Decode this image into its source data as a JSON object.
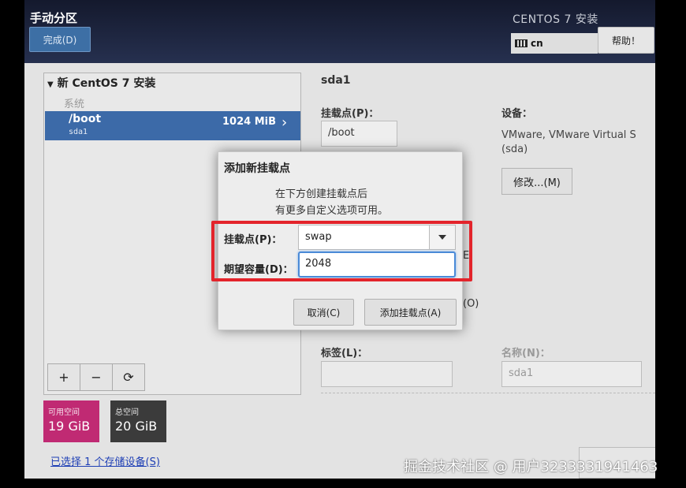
{
  "header": {
    "page_title": "手动分区",
    "done_label": "完成(D)",
    "install_title": "CENTOS 7 安装",
    "keyboard_layout": "cn",
    "help_label": "帮助！"
  },
  "tree": {
    "root_label": "新 CentOS 7 安装",
    "group_label": "系统",
    "partition": {
      "mount": "/boot",
      "device": "sda1",
      "size": "1024 MiB"
    },
    "buttons": {
      "add": "+",
      "remove": "−",
      "refresh": "⟳"
    }
  },
  "space": {
    "available_label": "可用空间",
    "available_value": "19 GiB",
    "total_label": "总空间",
    "total_value": "20 GiB"
  },
  "storage_link": "已选择 1 个存储设备(S)",
  "detail": {
    "title": "sda1",
    "mount_label": "挂载点(P)：",
    "mount_value": "/boot",
    "device_label": "设备：",
    "device_value": "VMware, VMware Virtual S (sda)",
    "modify_label": "修改...(M)",
    "frag_e": "E",
    "frag_o": "(O)",
    "tag_label": "标签(L)：",
    "tag_value": "",
    "name_label": "名称(N)：",
    "name_value": "sda1"
  },
  "dialog": {
    "title": "添加新挂载点",
    "desc_line1": "在下方创建挂载点后",
    "desc_line2": "有更多自定义选项可用。",
    "mount_label": "挂载点(P)：",
    "mount_value": "swap",
    "capacity_label": "期望容量(D)：",
    "capacity_value": "2048",
    "cancel_label": "取消(C)",
    "add_label": "添加挂载点(A)"
  },
  "colors": {
    "selection": "#3c6aa8",
    "available_bg": "#c02a73",
    "total_bg": "#3b3b3b",
    "highlight_frame": "#e3242b"
  },
  "watermark": "掘金技术社区 @ 用户3233331941463"
}
